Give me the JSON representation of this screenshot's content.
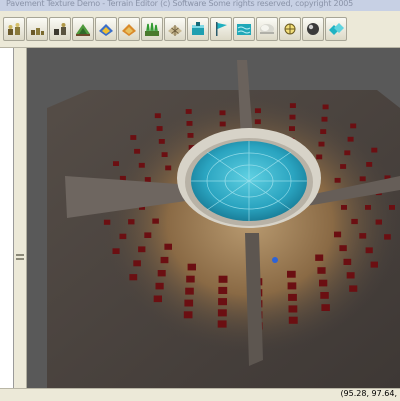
{
  "window": {
    "title": "Pavement Texture Demo - Terrain Editor (c) Software   Some rights reserved, copyright 2005"
  },
  "toolbar": {
    "buttons": [
      {
        "icon": "weights-icon"
      },
      {
        "icon": "weights-small-icon"
      },
      {
        "icon": "weights-dark-icon"
      },
      {
        "icon": "terrain-paint-icon"
      },
      {
        "icon": "texture-blue-icon"
      },
      {
        "icon": "texture-orange-icon"
      },
      {
        "icon": "grass-icon"
      },
      {
        "icon": "terrain-grid-icon"
      },
      {
        "icon": "water-level-icon"
      },
      {
        "icon": "flag-icon"
      },
      {
        "icon": "water-surface-icon"
      },
      {
        "icon": "fog-icon"
      },
      {
        "icon": "light-source-icon"
      },
      {
        "icon": "sphere-icon"
      },
      {
        "icon": "tiles-icon"
      }
    ]
  },
  "status": {
    "coords": "(95.28, 97.64,"
  },
  "colors": {
    "viewport_bg": "#595959",
    "water": "#2ba6c3",
    "floor": "#4a4440",
    "sand": "#8a6a45",
    "brick": "#6b0f12"
  }
}
